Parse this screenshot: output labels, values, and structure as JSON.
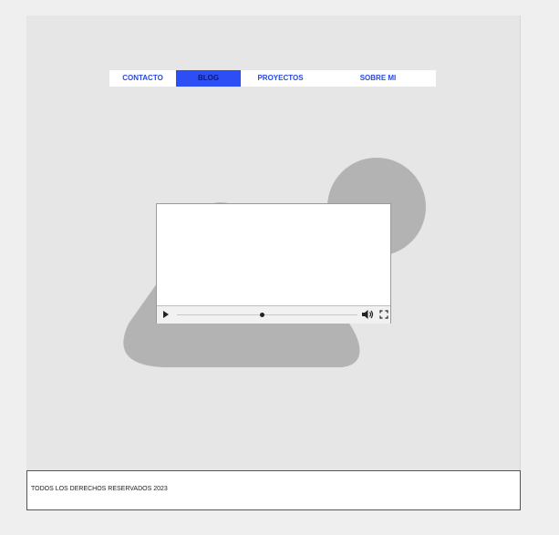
{
  "nav": {
    "items": [
      {
        "label": "CONTACTO"
      },
      {
        "label": "BLOG",
        "active": true
      },
      {
        "label": "PROYECTOS"
      },
      {
        "label": "SOBRE MI"
      }
    ]
  },
  "video": {
    "progress_fraction": 0.47,
    "icons": {
      "play": "play-icon",
      "volume": "volume-icon",
      "fullscreen": "fullscreen-icon"
    }
  },
  "footer": {
    "text": "TODOS LOS DERECHOS RESERVADOS 2023"
  },
  "colors": {
    "accent": "#2d4df5",
    "nav_link": "#2449e6",
    "background": "#e6e6e6",
    "shape": "#b3b3b3"
  }
}
